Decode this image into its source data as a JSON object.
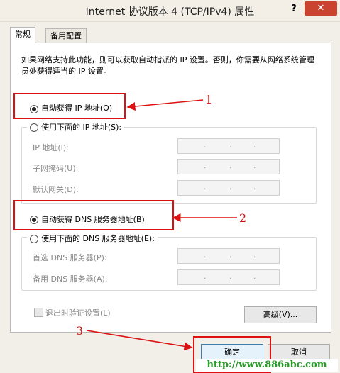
{
  "window": {
    "title": "Internet 协议版本 4 (TCP/IPv4) 属性",
    "help_label": "?",
    "close_label": "✕"
  },
  "tabs": [
    {
      "label": "常规"
    },
    {
      "label": "备用配置"
    }
  ],
  "description": "如果网络支持此功能，则可以获取自动指派的 IP 设置。否则，你需要从网络系统管理员处获得适当的 IP 设置。",
  "ip": {
    "auto_label": "自动获得 IP 地址(O)",
    "manual_label": "使用下面的 IP 地址(S):",
    "fields": [
      {
        "label": "IP 地址(I):"
      },
      {
        "label": "子网掩码(U):"
      },
      {
        "label": "默认网关(D):"
      }
    ]
  },
  "dns": {
    "auto_label": "自动获得 DNS 服务器地址(B)",
    "manual_label": "使用下面的 DNS 服务器地址(E):",
    "fields": [
      {
        "label": "首选 DNS 服务器(P):"
      },
      {
        "label": "备用 DNS 服务器(A):"
      }
    ]
  },
  "validate_label": "退出时验证设置(L)",
  "advanced_label": "高级(V)...",
  "ok_label": "确定",
  "cancel_label": "取消",
  "annotations": {
    "n1": "1",
    "n2": "2",
    "n3": "3",
    "watermark": "http://www.886abc.com"
  },
  "colors": {
    "annotation_red": "#d11111",
    "close_red": "#c9432f",
    "watermark_green": "#2a9a2a"
  }
}
